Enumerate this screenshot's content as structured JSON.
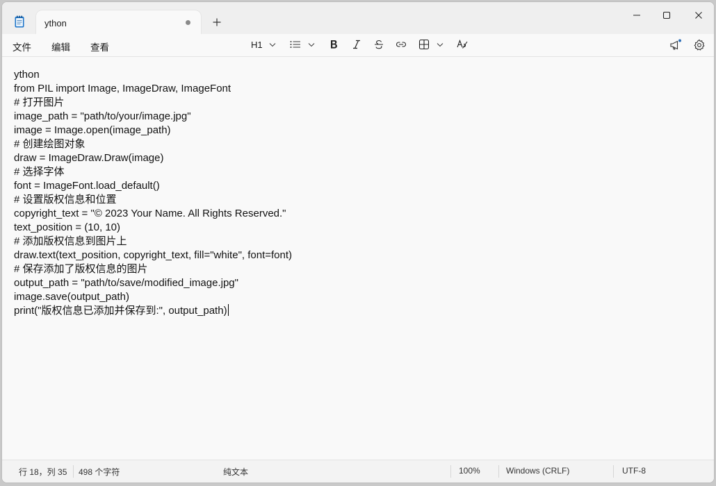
{
  "tab": {
    "title": "ython"
  },
  "menu": {
    "file": "文件",
    "edit": "编辑",
    "view": "查看"
  },
  "toolbar": {
    "heading": "H1"
  },
  "editor": {
    "lines": [
      "ython",
      "from PIL import Image, ImageDraw, ImageFont",
      "# 打开图片",
      "image_path = \"path/to/your/image.jpg\"",
      "image = Image.open(image_path)",
      "# 创建绘图对象",
      "draw = ImageDraw.Draw(image)",
      "# 选择字体",
      "font = ImageFont.load_default()",
      "# 设置版权信息和位置",
      "copyright_text = \"© 2023 Your Name. All Rights Reserved.\"",
      "text_position = (10, 10)",
      "# 添加版权信息到图片上",
      "draw.text(text_position, copyright_text, fill=\"white\", font=font)",
      "# 保存添加了版权信息的图片",
      "output_path = \"path/to/save/modified_image.jpg\"",
      "image.save(output_path)",
      "print(\"版权信息已添加并保存到:\", output_path)"
    ]
  },
  "status": {
    "position": "行 18，列 35",
    "chars": "498 个字符",
    "format": "纯文本",
    "zoom": "100%",
    "line_ending": "Windows (CRLF)",
    "encoding": "UTF-8"
  }
}
